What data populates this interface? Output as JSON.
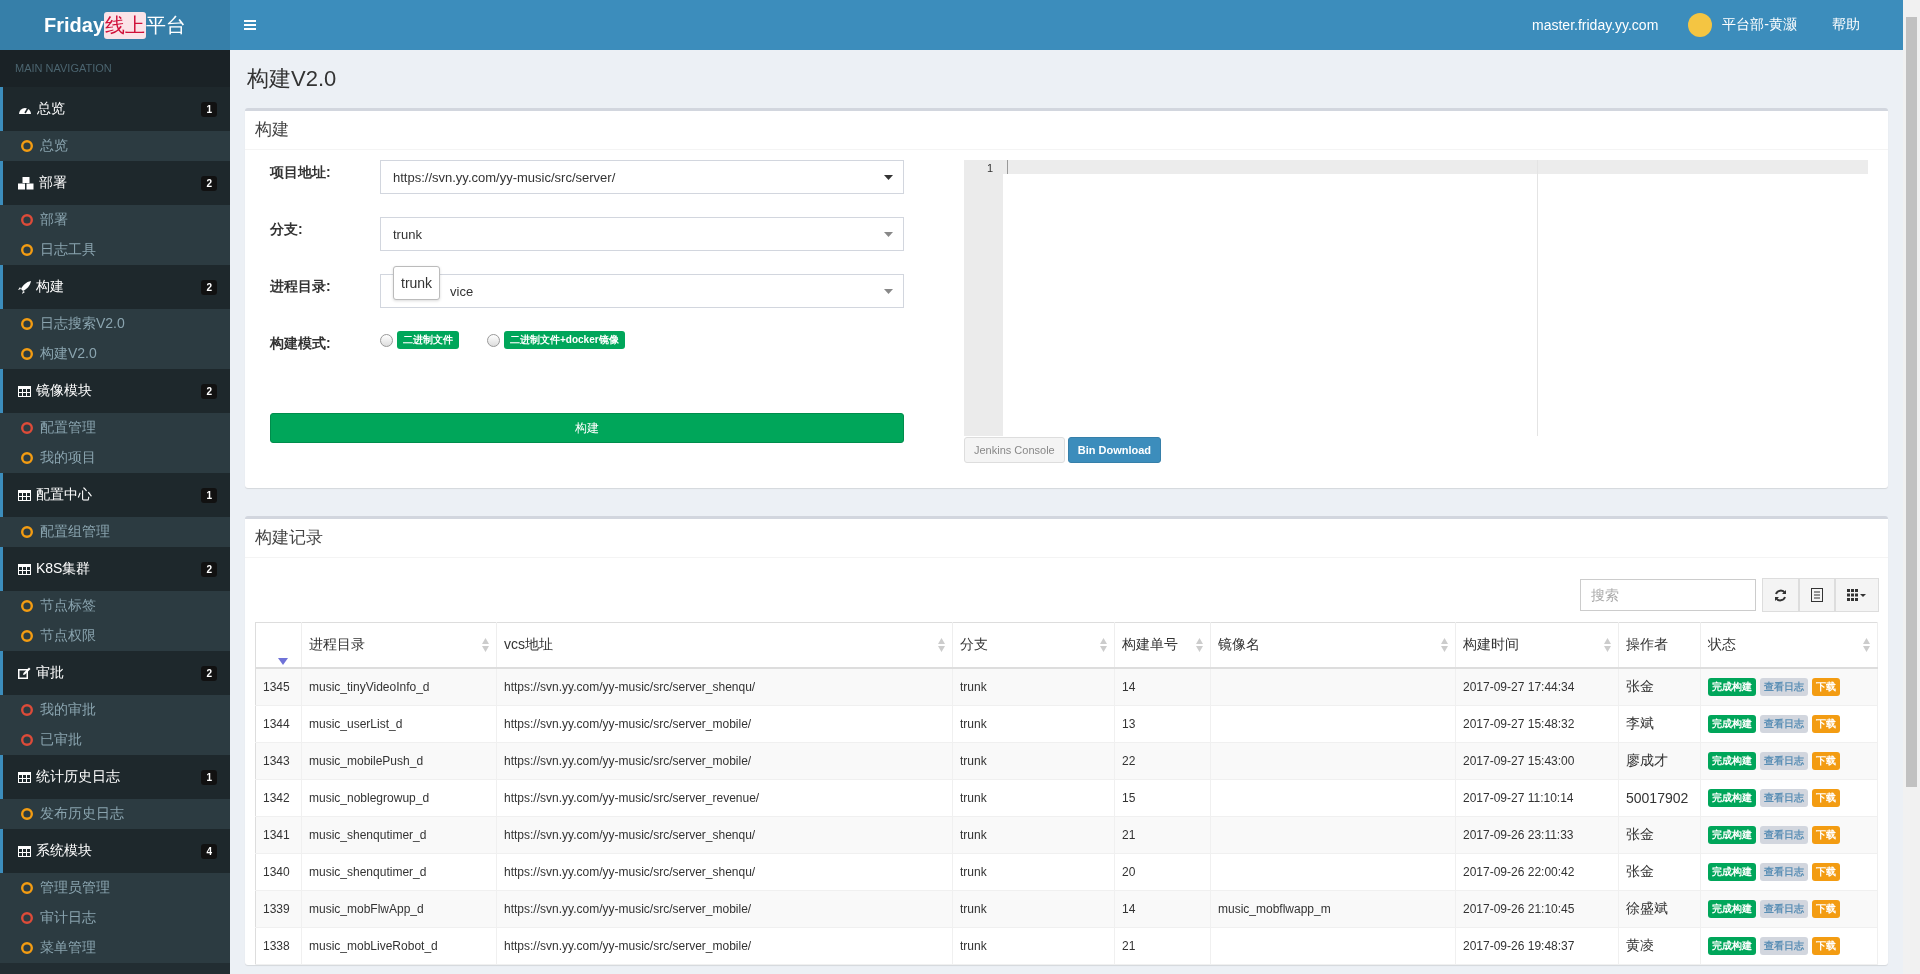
{
  "header": {
    "logo": {
      "name": "Friday",
      "tag": "线上",
      "suffix": "平台"
    },
    "host": "master.friday.yy.com",
    "user": "平台部-黄灏",
    "help": "帮助"
  },
  "sidebar": {
    "heading": "MAIN NAVIGATION",
    "groups": [
      {
        "kind": "dashboard",
        "label": "总览",
        "count": "1",
        "children": [
          {
            "label": "总览",
            "color": "#f39c12"
          }
        ]
      },
      {
        "kind": "cubes",
        "label": "部署",
        "count": "2",
        "children": [
          {
            "label": "部署",
            "color": "#dd4b39"
          },
          {
            "label": "日志工具",
            "color": "#f39c12"
          }
        ]
      },
      {
        "kind": "rocket",
        "label": "构建",
        "count": "2",
        "children": [
          {
            "label": "日志搜索V2.0",
            "color": "#f39c12"
          },
          {
            "label": "构建V2.0",
            "color": "#f39c12"
          }
        ]
      },
      {
        "kind": "table",
        "label": "镜像模块",
        "count": "2",
        "children": [
          {
            "label": "配置管理",
            "color": "#dd4b39"
          },
          {
            "label": "我的项目",
            "color": "#f39c12"
          }
        ]
      },
      {
        "kind": "table",
        "label": "配置中心",
        "count": "1",
        "children": [
          {
            "label": "配置组管理",
            "color": "#f39c12"
          }
        ]
      },
      {
        "kind": "table",
        "label": "K8S集群",
        "count": "2",
        "children": [
          {
            "label": "节点标签",
            "color": "#f39c12"
          },
          {
            "label": "节点权限",
            "color": "#f39c12"
          }
        ]
      },
      {
        "kind": "edit",
        "label": "审批",
        "count": "2",
        "children": [
          {
            "label": "我的审批",
            "color": "#dd4b39"
          },
          {
            "label": "已审批",
            "color": "#dd4b39"
          }
        ]
      },
      {
        "kind": "table",
        "label": "统计历史日志",
        "count": "1",
        "children": [
          {
            "label": "发布历史日志",
            "color": "#f39c12"
          }
        ]
      },
      {
        "kind": "table",
        "label": "系统模块",
        "count": "4",
        "children": [
          {
            "label": "管理员管理",
            "color": "#f39c12"
          },
          {
            "label": "审计日志",
            "color": "#dd4b39"
          },
          {
            "label": "菜单管理",
            "color": "#f39c12"
          }
        ]
      }
    ]
  },
  "page_title": "构建V2.0",
  "build": {
    "title": "构建",
    "fields": [
      {
        "kind": "select",
        "label": "项目地址:",
        "value": "https://svn.yy.com/yy-music/src/server/"
      },
      {
        "kind": "select",
        "label": "分支:",
        "value": "trunk"
      },
      {
        "kind": "select",
        "label": "进程目录:",
        "value": "vice",
        "tooltip": "trunk"
      },
      {
        "kind": "radios",
        "label": "构建模式:",
        "options": [
          {
            "label": "二进制文件",
            "checked": false
          },
          {
            "label": "二进制文件+docker镜像",
            "checked": false
          }
        ]
      }
    ],
    "submit": "构建",
    "editor": {
      "line_number": "1"
    },
    "buttons": [
      {
        "kind": "default",
        "label": "Jenkins Console"
      },
      {
        "kind": "primary",
        "label": "Bin Download"
      }
    ]
  },
  "records": {
    "title": "构建记录",
    "search": {
      "placeholder": "搜索"
    },
    "columns": [
      {
        "sortable": false,
        "sorted": true
      },
      {
        "label": "进程目录",
        "sortable": true,
        "sorted": false
      },
      {
        "label": "vcs地址",
        "sortable": true,
        "sorted": false
      },
      {
        "label": "分支",
        "sortable": true,
        "sorted": false
      },
      {
        "label": "构建单号",
        "sortable": true,
        "sorted": false
      },
      {
        "label": "镜像名",
        "sortable": true,
        "sorted": false
      },
      {
        "label": "构建时间",
        "sortable": true,
        "sorted": false
      },
      {
        "label": "操作者",
        "sortable": false,
        "sorted": false
      },
      {
        "label": "状态",
        "sortable": true,
        "sorted": false
      }
    ],
    "rows": [
      {
        "id": "1345",
        "dir": "music_tinyVideoInfo_d",
        "vcs": "https://svn.yy.com/yy-music/src/server_shenqu/",
        "branch": "trunk",
        "number": "14",
        "time": "2017-09-27 17:44:34",
        "operator": "张金",
        "actions": [
          {
            "kind": "done",
            "label": "完成构建"
          },
          {
            "kind": "log",
            "label": "查看日志"
          },
          {
            "kind": "download",
            "label": "下载"
          }
        ]
      },
      {
        "id": "1344",
        "dir": "music_userList_d",
        "vcs": "https://svn.yy.com/yy-music/src/server_mobile/",
        "branch": "trunk",
        "number": "13",
        "time": "2017-09-27 15:48:32",
        "operator": "李斌",
        "actions": [
          {
            "kind": "done",
            "label": "完成构建"
          },
          {
            "kind": "log",
            "label": "查看日志"
          },
          {
            "kind": "download",
            "label": "下载"
          }
        ]
      },
      {
        "id": "1343",
        "dir": "music_mobilePush_d",
        "vcs": "https://svn.yy.com/yy-music/src/server_mobile/",
        "branch": "trunk",
        "number": "22",
        "time": "2017-09-27 15:43:00",
        "operator": "廖成才",
        "actions": [
          {
            "kind": "done",
            "label": "完成构建"
          },
          {
            "kind": "log",
            "label": "查看日志"
          },
          {
            "kind": "download",
            "label": "下载"
          }
        ]
      },
      {
        "id": "1342",
        "dir": "music_noblegrowup_d",
        "vcs": "https://svn.yy.com/yy-music/src/server_revenue/",
        "branch": "trunk",
        "number": "15",
        "time": "2017-09-27 11:10:14",
        "operator": "50017902",
        "actions": [
          {
            "kind": "done",
            "label": "完成构建"
          },
          {
            "kind": "log",
            "label": "查看日志"
          },
          {
            "kind": "download",
            "label": "下载"
          }
        ]
      },
      {
        "id": "1341",
        "dir": "music_shenqutimer_d",
        "vcs": "https://svn.yy.com/yy-music/src/server_shenqu/",
        "branch": "trunk",
        "number": "21",
        "time": "2017-09-26 23:11:33",
        "operator": "张金",
        "actions": [
          {
            "kind": "done",
            "label": "完成构建"
          },
          {
            "kind": "log",
            "label": "查看日志"
          },
          {
            "kind": "download",
            "label": "下载"
          }
        ]
      },
      {
        "id": "1340",
        "dir": "music_shenqutimer_d",
        "vcs": "https://svn.yy.com/yy-music/src/server_shenqu/",
        "branch": "trunk",
        "number": "20",
        "time": "2017-09-26 22:00:42",
        "operator": "张金",
        "actions": [
          {
            "kind": "done",
            "label": "完成构建"
          },
          {
            "kind": "log",
            "label": "查看日志"
          },
          {
            "kind": "download",
            "label": "下载"
          }
        ]
      },
      {
        "id": "1339",
        "dir": "music_mobFlwApp_d",
        "vcs": "https://svn.yy.com/yy-music/src/server_mobile/",
        "branch": "trunk",
        "number": "14",
        "image": "music_mobflwapp_m",
        "time": "2017-09-26 21:10:45",
        "operator": "徐盛斌",
        "actions": [
          {
            "kind": "done",
            "label": "完成构建"
          },
          {
            "kind": "log",
            "label": "查看日志"
          },
          {
            "kind": "download",
            "label": "下载"
          }
        ]
      },
      {
        "id": "1338",
        "dir": "music_mobLiveRobot_d",
        "vcs": "https://svn.yy.com/yy-music/src/server_mobile/",
        "branch": "trunk",
        "number": "21",
        "time": "2017-09-26 19:48:37",
        "operator": "黄凌",
        "actions": [
          {
            "kind": "done",
            "label": "完成构建"
          },
          {
            "kind": "log",
            "label": "查看日志"
          },
          {
            "kind": "download",
            "label": "下载"
          }
        ]
      }
    ]
  }
}
